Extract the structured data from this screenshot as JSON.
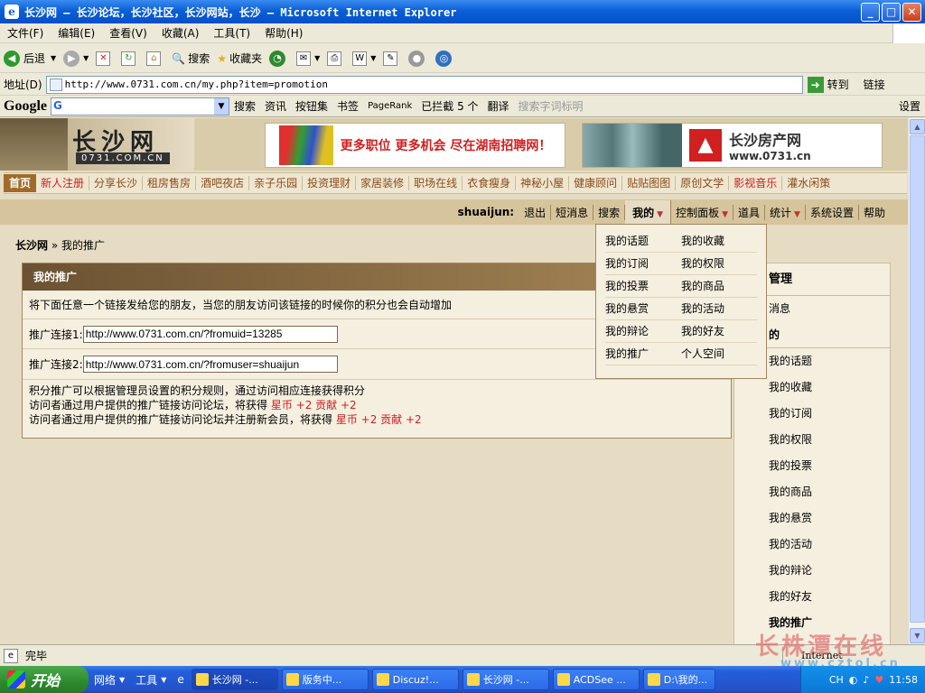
{
  "window": {
    "title": "长沙网 – 长沙论坛，长沙社区，长沙网站，长沙 – Microsoft Internet Explorer",
    "minimize": "_",
    "maximize": "□",
    "close": "✕"
  },
  "menubar": [
    "文件(F)",
    "编辑(E)",
    "查看(V)",
    "收藏(A)",
    "工具(T)",
    "帮助(H)"
  ],
  "toolbar": {
    "back": "后退",
    "search": "搜索",
    "favorites": "收藏夹"
  },
  "address": {
    "label": "地址(D)",
    "url": "http://www.0731.com.cn/my.php?item=promotion",
    "go": "转到",
    "links": "链接"
  },
  "googlebar": {
    "logo": "Google",
    "search": "搜索",
    "news": "资讯",
    "buttons": "按钮集",
    "bookmarks": "书签",
    "pagerank": "PageRank",
    "blocked": "已拦截 5 个",
    "translate": "翻译",
    "highlight": "搜索字词标明",
    "settings": "设置"
  },
  "site": {
    "logo_cn": "长沙网",
    "logo_domain": "0731.COM.CN",
    "ad1": "更多职位 更多机会 尽在湖南招聘网！",
    "ad2_title": "长沙房产网",
    "ad2_url": "www.0731.cn"
  },
  "nav": {
    "home": "首页",
    "items": [
      "新人注册",
      "分享长沙",
      "租房售房",
      "酒吧夜店",
      "亲子乐园",
      "投资理财",
      "家居装修",
      "职场在线",
      "衣食瘦身",
      "神秘小屋",
      "健康顾问",
      "贴贴图图",
      "原创文学",
      "影视音乐",
      "灌水闲策"
    ]
  },
  "userbar": {
    "username": "shuaijun:",
    "logout": "退出",
    "pm": "短消息",
    "search": "搜索",
    "my": "我的",
    "control": "控制面板",
    "tools": "道具",
    "stats": "统计",
    "settings": "系统设置",
    "help": "帮助"
  },
  "breadcrumb": {
    "home": "长沙网",
    "sep": "»",
    "current": "我的推广"
  },
  "panel": {
    "title": "我的推广",
    "intro": "将下面任意一个链接发给您的朋友，当您的朋友访问该链接的时候你的积分也会自动增加",
    "link1_label": "推广连接1:",
    "link1_value": "http://www.0731.com.cn/?fromuid=13285",
    "link2_label": "推广连接2:",
    "link2_value": "http://www.0731.com.cn/?fromuser=shuaijun",
    "rule1": "积分推广可以根据管理员设置的积分规则，通过访问相应连接获得积分",
    "rule2_text": "访问者通过用户提供的推广链接访问论坛，将获得",
    "rule2_reward": "星币 +2 贡献 +2",
    "rule3_text": "访问者通过用户提供的推广链接访问论坛并注册新会员，将获得",
    "rule3_reward": "星币 +2 贡献 +2"
  },
  "dropdown": {
    "items": [
      "我的话题",
      "我的收藏",
      "我的订阅",
      "我的权限",
      "我的投票",
      "我的商品",
      "我的悬赏",
      "我的活动",
      "我的辩论",
      "我的好友",
      "我的推广",
      "个人空间"
    ]
  },
  "sidebar": {
    "heading": "管理",
    "messages": "消息",
    "my_heading": "的",
    "items": [
      "我的话题",
      "我的收藏",
      "我的订阅",
      "我的权限",
      "我的投票",
      "我的商品",
      "我的悬赏",
      "我的活动",
      "我的辩论",
      "我的好友",
      "我的推广"
    ]
  },
  "status": {
    "text": "完毕",
    "zone": "Internet"
  },
  "watermark": {
    "line1": "长株潭在线",
    "line2": "www.cztol.cn"
  },
  "taskbar": {
    "start": "开始",
    "quick": [
      "网络",
      "工具"
    ],
    "buttons": [
      "长沙网 -...",
      "版务中...",
      "Discuz!...",
      "长沙网 -...",
      "ACDSee ...",
      "D:\\我的..."
    ],
    "lang": "CH",
    "clock": "11:58"
  },
  "colors": {
    "accent": "#a06a2a",
    "nav_text": "#8b4b1b",
    "reward": "#d02020",
    "panel_header": "#6b5232"
  }
}
